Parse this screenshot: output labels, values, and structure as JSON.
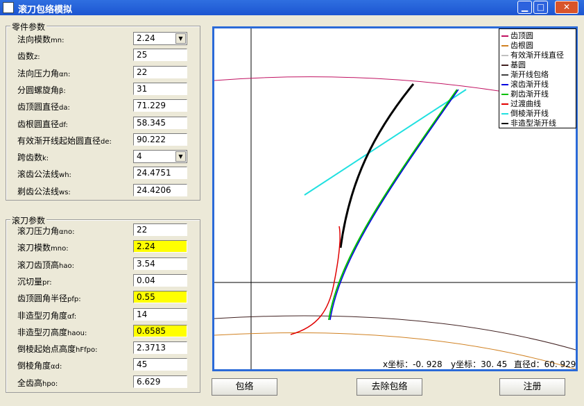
{
  "window": {
    "title": "滚刀包络模拟"
  },
  "part_params": {
    "title": "零件参数",
    "items": [
      {
        "label": "法向模数",
        "sub": "mn:",
        "value": "2.24",
        "type": "select"
      },
      {
        "label": "齿数",
        "sub": "z:",
        "value": "25"
      },
      {
        "label": "法向压力角",
        "sub": "αn:",
        "value": "22"
      },
      {
        "label": "分圆螺旋角",
        "sub": "β:",
        "value": "31"
      },
      {
        "label": "齿顶圆直径",
        "sub": "da:",
        "value": "71.229"
      },
      {
        "label": "齿根圆直径",
        "sub": "df:",
        "value": "58.345"
      },
      {
        "label": "有效渐开线起始圆直径",
        "sub": "de:",
        "value": "90.222"
      },
      {
        "label": "跨齿数",
        "sub": "k:",
        "value": "4",
        "type": "select"
      },
      {
        "label": "滚齿公法线",
        "sub": "wh:",
        "value": "24.4751"
      },
      {
        "label": "剃齿公法线",
        "sub": "ws:",
        "value": "24.4206"
      }
    ]
  },
  "hob_params": {
    "title": "滚刀参数",
    "items": [
      {
        "label": "滚刀压力角",
        "sub": "αno:",
        "value": "22"
      },
      {
        "label": "滚刀模数",
        "sub": "mno:",
        "value": "2.24",
        "highlight": true
      },
      {
        "label": "滚刀齿顶高",
        "sub": "hao:",
        "value": "3.54"
      },
      {
        "label": "沉切量",
        "sub": "pr:",
        "value": "0.04"
      },
      {
        "label": "齿顶圆角半径",
        "sub": "pfp:",
        "value": "0.55",
        "highlight": true
      },
      {
        "label": "非造型刃角度",
        "sub": "αf:",
        "value": "14"
      },
      {
        "label": "非造型刃高度",
        "sub": "haou:",
        "value": "0.6585",
        "highlight": true
      },
      {
        "label": "倒棱起始点高度",
        "sub": "hFfpo:",
        "value": "2.3713"
      },
      {
        "label": "倒棱角度",
        "sub": "αd:",
        "value": "45"
      },
      {
        "label": "全齿高",
        "sub": "hpo:",
        "value": "6.629"
      }
    ]
  },
  "legend": [
    {
      "label": "齿顶圆",
      "color": "#c01060"
    },
    {
      "label": "齿根圆",
      "color": "#d08020"
    },
    {
      "label": "有效渐开线直径",
      "color": "#c0c0c0"
    },
    {
      "label": "基圆",
      "color": "#402020"
    },
    {
      "label": "渐开线包络",
      "color": "#404040"
    },
    {
      "label": "滚齿渐开线",
      "color": "#0000e0"
    },
    {
      "label": "剃齿渐开线",
      "color": "#00c000"
    },
    {
      "label": "过渡曲线",
      "color": "#e00000"
    },
    {
      "label": "倒棱渐开线",
      "color": "#20e0e0"
    },
    {
      "label": "非造型渐开线",
      "color": "#000000"
    }
  ],
  "coords": {
    "x": "x坐标：-0. 928",
    "y": "y坐标：30. 45",
    "d": "直径d：60. 929"
  },
  "buttons": {
    "envelope": "包络",
    "remove": "去除包络",
    "register": "注册"
  }
}
